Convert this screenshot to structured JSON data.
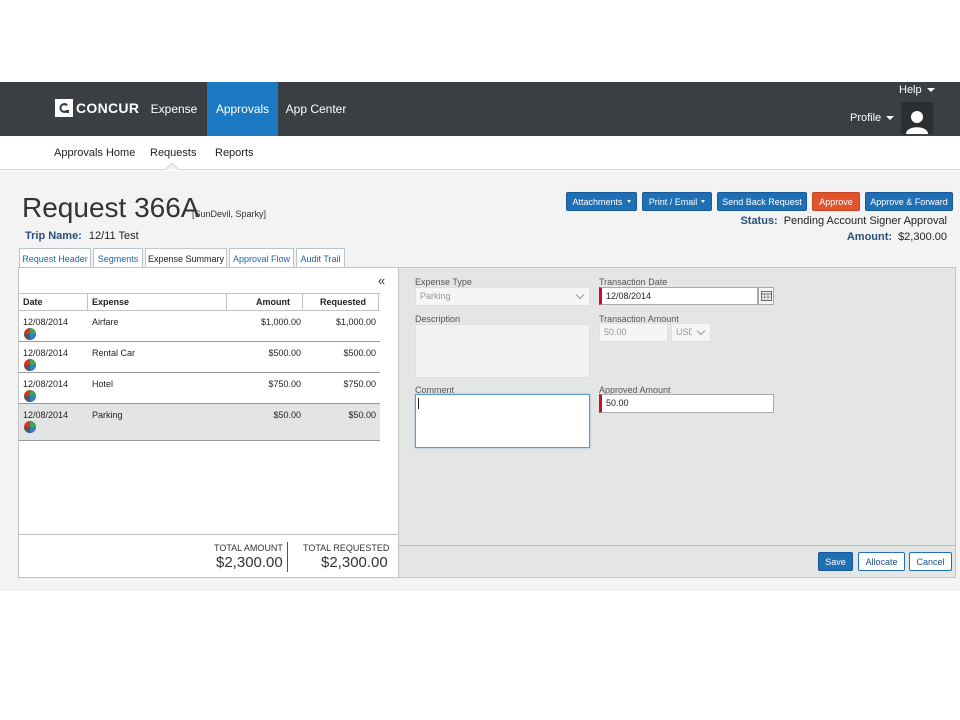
{
  "header": {
    "logo_text": "CONCUR",
    "nav": [
      {
        "label": "Expense"
      },
      {
        "label": "Approvals"
      },
      {
        "label": "App Center"
      }
    ],
    "help_label": "Help",
    "profile_label": "Profile"
  },
  "subnav": {
    "items": [
      {
        "label": "Approvals Home"
      },
      {
        "label": "Requests"
      },
      {
        "label": "Reports"
      }
    ]
  },
  "request": {
    "title": "Request 366A",
    "user": "[SunDevil, Sparky]",
    "trip_label": "Trip Name:",
    "trip_value": "12/11 Test",
    "status_label": "Status:",
    "status_value": "Pending Account Signer Approval",
    "amount_label": "Amount:",
    "amount_value": "$2,300.00"
  },
  "actions": {
    "attachments": "Attachments",
    "print_email": "Print / Email",
    "send_back": "Send Back Request",
    "approve": "Approve",
    "approve_forward": "Approve & Forward"
  },
  "tabs": [
    {
      "label": "Request Header"
    },
    {
      "label": "Segments"
    },
    {
      "label": "Expense Summary"
    },
    {
      "label": "Approval Flow"
    },
    {
      "label": "Audit Trail"
    }
  ],
  "table": {
    "collapse_glyph": "«",
    "headers": {
      "date": "Date",
      "expense": "Expense",
      "amount": "Amount",
      "requested": "Requested"
    },
    "rows": [
      {
        "date": "12/08/2014",
        "expense": "Airfare",
        "amount": "$1,000.00",
        "requested": "$1,000.00"
      },
      {
        "date": "12/08/2014",
        "expense": "Rental Car",
        "amount": "$500.00",
        "requested": "$500.00"
      },
      {
        "date": "12/08/2014",
        "expense": "Hotel",
        "amount": "$750.00",
        "requested": "$750.00"
      },
      {
        "date": "12/08/2014",
        "expense": "Parking",
        "amount": "$50.00",
        "requested": "$50.00"
      }
    ],
    "total_amount_label": "TOTAL AMOUNT",
    "total_amount_value": "$2,300.00",
    "total_requested_label": "TOTAL REQUESTED",
    "total_requested_value": "$2,300.00"
  },
  "form": {
    "expense_type_label": "Expense Type",
    "expense_type_value": "Parking",
    "transaction_date_label": "Transaction Date",
    "transaction_date_value": "12/08/2014",
    "description_label": "Description",
    "transaction_amount_label": "Transaction Amount",
    "transaction_amount_value": "50.00",
    "currency_value": "USD",
    "comment_label": "Comment",
    "approved_amount_label": "Approved Amount",
    "approved_amount_value": "50.00",
    "save": "Save",
    "allocate": "Allocate",
    "cancel": "Cancel"
  },
  "colors": {
    "topbar": "#3b3e43",
    "accent": "#1b79c4",
    "approve": "#e2552c",
    "required": "#c8102e"
  },
  "icons": [
    "concur-logo-icon",
    "caret-down-icon",
    "user-avatar-icon",
    "collapse-icon",
    "expense-pie-icon",
    "calendar-icon",
    "chevron-down-icon"
  ]
}
